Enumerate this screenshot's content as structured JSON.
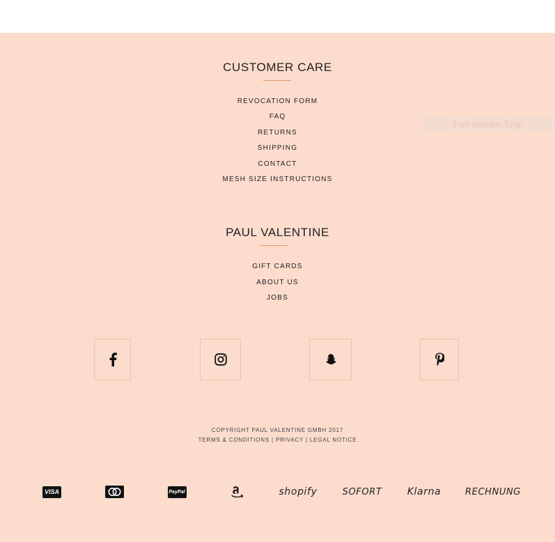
{
  "overlay": {
    "snip_label": "Full-screen Snip"
  },
  "customer_care": {
    "title": "CUSTOMER CARE",
    "links": [
      "REVOCATION FORM",
      "FAQ",
      "RETURNS",
      "SHIPPING",
      "CONTACT",
      "MESH SIZE INSTRUCTIONS"
    ]
  },
  "brand": {
    "title": "PAUL VALENTINE",
    "links": [
      "GIFT CARDS",
      "ABOUT US",
      "JOBS"
    ]
  },
  "social": [
    {
      "icon": "facebook-icon"
    },
    {
      "icon": "instagram-icon"
    },
    {
      "icon": "snapchat-icon"
    },
    {
      "icon": "pinterest-icon"
    }
  ],
  "footer": {
    "copyright": "COPYRIGHT PAUL VALENTINE GMBH 2017",
    "terms": "TERMS & CONDITIONS",
    "privacy": "PRIVACY",
    "legal": "LEGAL NOTICE",
    "separator": " | "
  },
  "payments": {
    "visa": "VISA",
    "mastercard_icon": "mastercard-icon",
    "paypal": "PayPal",
    "amazon_icon": "amazon-icon",
    "shopify": "shopify",
    "sofort": "SOFORT",
    "klarna": "Klarna",
    "rechnung": "RECHNUNG"
  },
  "colors": {
    "background": "#fcdccd",
    "accent": "#e8955f",
    "border": "#ecc3a2"
  }
}
